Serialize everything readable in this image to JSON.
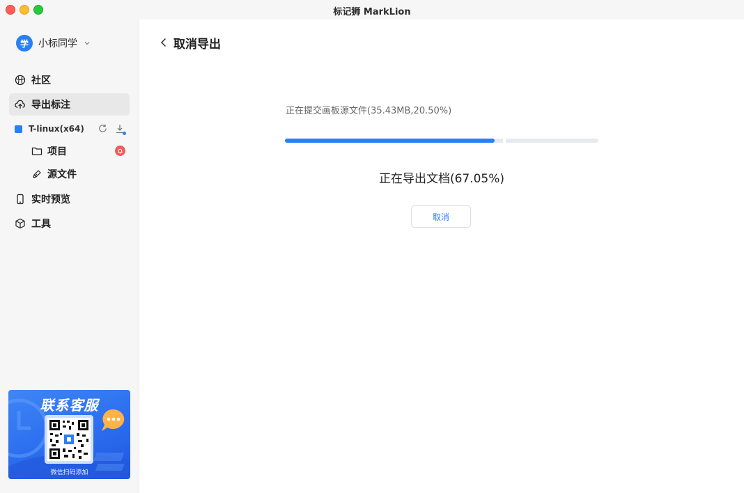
{
  "window": {
    "title": "标记狮 MarkLion"
  },
  "user": {
    "avatar_char": "学",
    "name": "小标同学"
  },
  "nav": {
    "community": "社区",
    "export": "导出标注",
    "preview": "实时预览",
    "tools": "工具"
  },
  "project": {
    "name": "T-linux(x64)",
    "color": "#2a7ff5",
    "items": {
      "projects": "项目",
      "source_files": "源文件"
    }
  },
  "promo": {
    "title": "联系客服",
    "subtitle": "微信扫码添加"
  },
  "main": {
    "back_label": "取消导出",
    "upload_status": "正在提交画板源文件(35.43MB,20.50%)",
    "export_status": "正在导出文档(67.05%)",
    "progress_upload": 0.205,
    "progress_export": 0.6705,
    "cancel_label": "取消"
  },
  "colors": {
    "accent": "#2a7ff5",
    "badge": "#f25a5a"
  }
}
